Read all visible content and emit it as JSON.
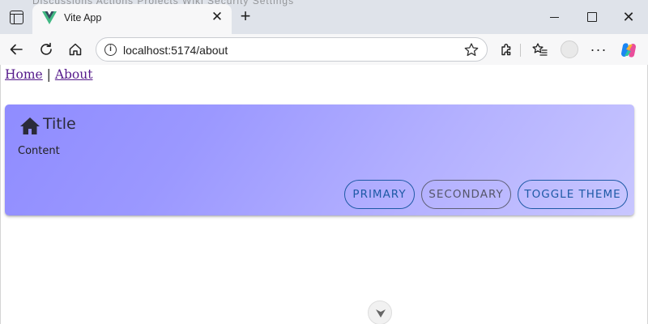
{
  "browser": {
    "ghost_tabs_text": "Discussions    Actions    Projects    Wiki    Security    Settings",
    "active_tab": {
      "title": "Vite App",
      "favicon": "vue-logo-icon",
      "close": "✕"
    },
    "new_tab": "+",
    "window_close": "✕",
    "address": {
      "url": "localhost:5174/about",
      "info": "i"
    },
    "more_menu": "···"
  },
  "page": {
    "nav": {
      "home": "Home",
      "separator": " | ",
      "about": "About"
    },
    "card": {
      "icon": "home-icon",
      "title": "Title",
      "content": "Content",
      "gradient": [
        "#8f8cff",
        "#c8c6ff"
      ],
      "buttons": {
        "primary": "PRIMARY",
        "secondary": "SECONDARY",
        "toggle_theme": "TOGGLE THEME"
      },
      "accent_color": "#1e5aa6"
    }
  }
}
